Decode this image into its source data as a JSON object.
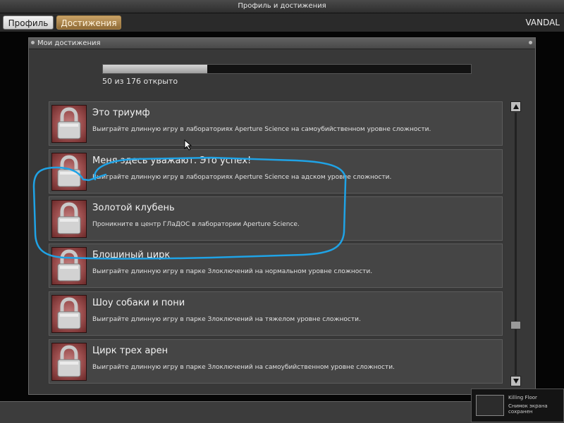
{
  "window": {
    "title": "Профиль и достижения"
  },
  "tabs": [
    {
      "label": "Профиль",
      "active": false
    },
    {
      "label": "Достижения",
      "active": true
    }
  ],
  "user": {
    "name": "VANDAL"
  },
  "panel": {
    "title": "Мои достижения",
    "progress": {
      "unlocked": 50,
      "total": 176,
      "text": "50 из 176 открыто"
    }
  },
  "achievements": [
    {
      "name": "Это триумф",
      "description": "Выиграйте длинную игру в лабораториях Aperture Science на самоубийственном уровне сложности.",
      "icon": "lock-icon",
      "locked": true
    },
    {
      "name": "Меня здесь уважают. Это успех!",
      "description": "Выиграйте длинную игру в лабораториях Aperture Science на адском уровне сложности.",
      "icon": "lock-icon",
      "locked": true
    },
    {
      "name": "Золотой клубень",
      "description": "Проникните в центр ГЛаДОС в лаборатории Aperture Science.",
      "icon": "lock-icon",
      "locked": true
    },
    {
      "name": "Блошиный цирк",
      "description": "Выиграйте длинную игру в парке Злоключений на нормальном уровне сложности.",
      "icon": "lock-icon",
      "locked": true
    },
    {
      "name": "Шоу собаки и пони",
      "description": "Выиграйте длинную игру в парке Злоключений на тяжелом уровне сложности.",
      "icon": "lock-icon",
      "locked": true
    },
    {
      "name": "Цирк трех арен",
      "description": "Выиграйте длинную игру в парке Злоключений на самоубийственном уровне сложности.",
      "icon": "lock-icon",
      "locked": true
    }
  ],
  "scrollbar": {
    "position_fraction": 0.82
  },
  "notification": {
    "app": "Killing Floor",
    "message": "Снимок экрана сохранен"
  },
  "colors": {
    "accent_tab": "#b08a4e",
    "lock_background": "#9a4d4d",
    "annotation_stroke": "#1fa3e6",
    "progress_fill": "#c2c2c2"
  }
}
